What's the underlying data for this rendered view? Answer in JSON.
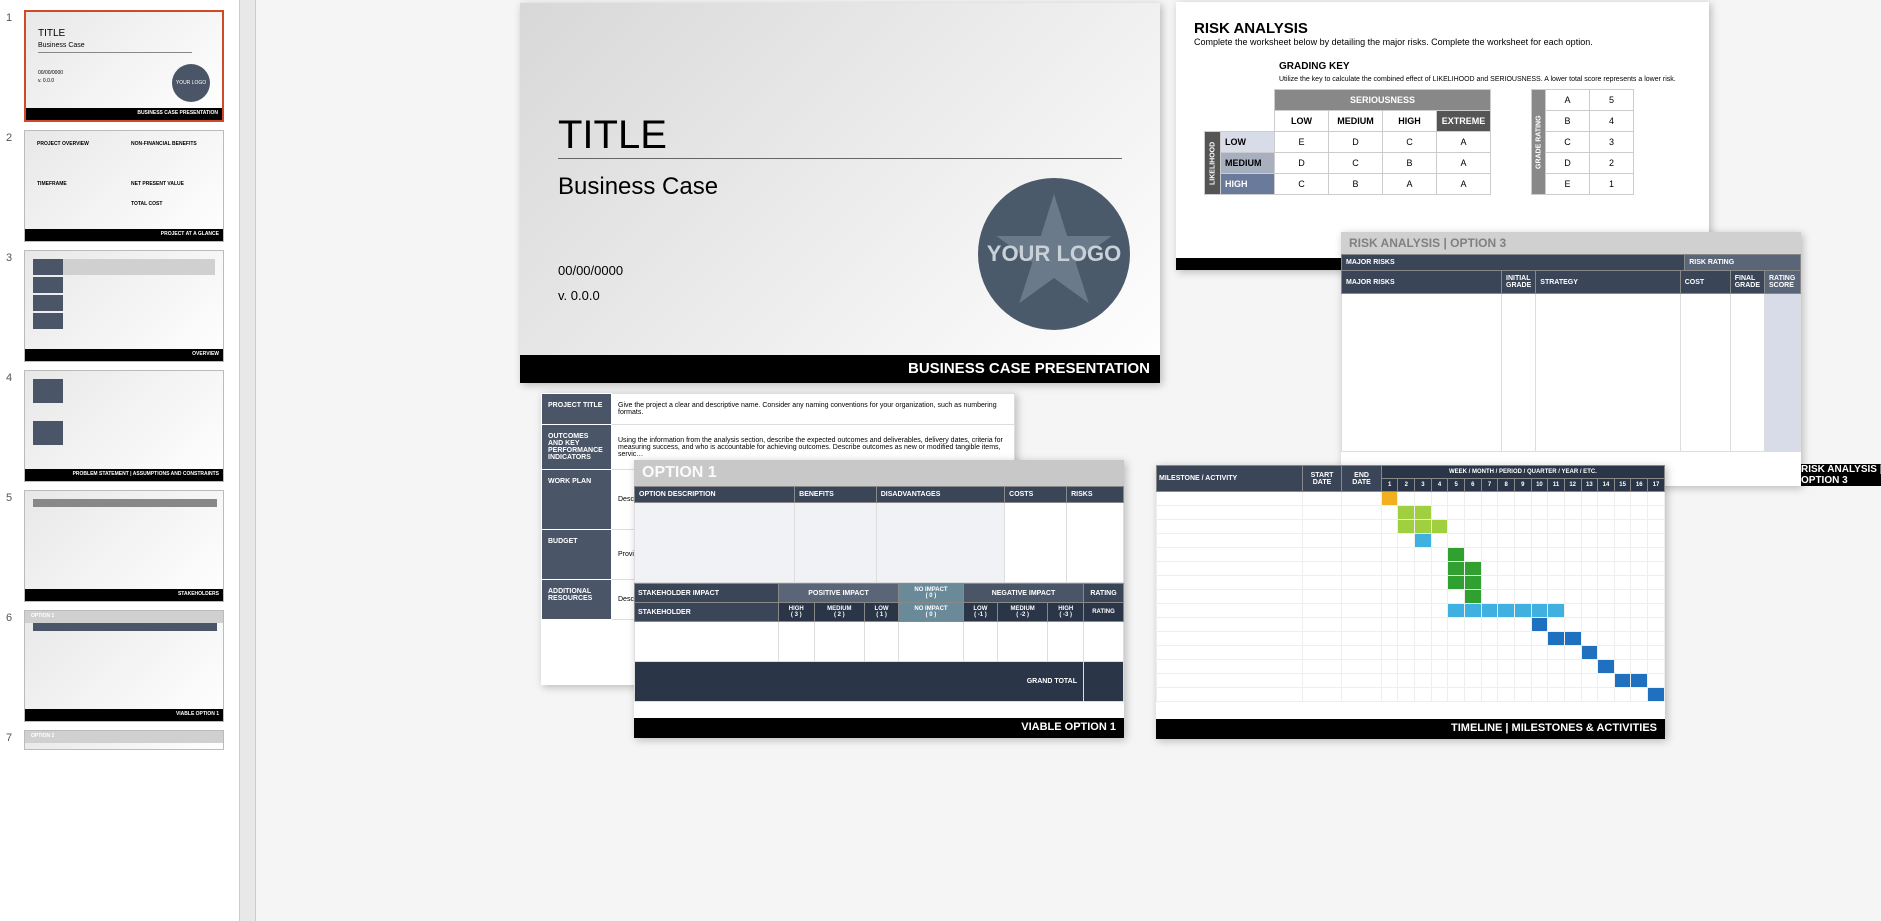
{
  "thumbnails": [
    {
      "num": "1",
      "title": "TITLE",
      "sub": "Business Case",
      "footer": "BUSINESS CASE PRESENTATION",
      "logo": "YOUR LOGO",
      "date": "00/00/0000",
      "ver": "v. 0.0.0"
    },
    {
      "num": "2",
      "footer": "PROJECT AT A GLANCE",
      "sections": [
        "PROJECT OVERVIEW",
        "NON-FINANCIAL BENEFITS",
        "TIMEFRAME",
        "NET PRESENT VALUE",
        "TOTAL COST"
      ]
    },
    {
      "num": "3",
      "footer": "OVERVIEW"
    },
    {
      "num": "4",
      "footer": "PROBLEM STATEMENT | ASSUMPTIONS AND CONSTRAINTS"
    },
    {
      "num": "5",
      "footer": "STAKEHOLDERS"
    },
    {
      "num": "6",
      "header": "OPTION 1",
      "footer": "VIABLE OPTION 1"
    },
    {
      "num": "7",
      "header": "OPTION 2"
    }
  ],
  "main_slide": {
    "title": "TITLE",
    "subtitle": "Business Case",
    "date": "00/00/0000",
    "version": "v. 0.0.0",
    "logo": "YOUR LOGO",
    "footer": "BUSINESS CASE PRESENTATION"
  },
  "risk_analysis": {
    "title": "RISK ANALYSIS",
    "desc": "Complete the worksheet below by detailing the major risks.  Complete the worksheet for each option.",
    "grading_key": "GRADING KEY",
    "grading_desc": "Utilize the key to calculate the combined effect of LIKELIHOOD and SERIOUSNESS. A lower total score represents a lower risk.",
    "seriousness": "SERIOUSNESS",
    "likelihood": "LIKELIHOOD",
    "grade_rating": "GRADE RATING",
    "cols": [
      "LOW",
      "MEDIUM",
      "HIGH",
      "EXTREME"
    ],
    "rows": [
      "LOW",
      "MEDIUM",
      "HIGH"
    ],
    "matrix": [
      [
        "E",
        "D",
        "C",
        "A"
      ],
      [
        "D",
        "C",
        "B",
        "A"
      ],
      [
        "C",
        "B",
        "A",
        "A"
      ]
    ],
    "grades": [
      [
        "A",
        "5"
      ],
      [
        "B",
        "4"
      ],
      [
        "C",
        "3"
      ],
      [
        "D",
        "2"
      ],
      [
        "E",
        "1"
      ]
    ]
  },
  "risk_option3": {
    "header": "RISK ANALYSIS | OPTION 3",
    "cols": [
      "RISK RATING",
      "MAJOR RISKS",
      "INITIAL GRADE",
      "STRATEGY",
      "COST",
      "FINAL GRADE",
      "RATING SCORE"
    ],
    "footer": "RISK ANALYSIS | OPTION 3"
  },
  "project_details": {
    "rows": [
      {
        "label": "PROJECT TITLE",
        "text": "Give the project a clear and descriptive name. Consider any naming conventions for your organization, such as numbering formats."
      },
      {
        "label": "OUTCOMES AND KEY PERFORMANCE INDICATORS",
        "text": "Using the information from the analysis section, describe the expected outcomes and deliverables, delivery dates, criteria for measuring success, and who is accountable for achieving outcomes. Describe outcomes as new or modified tangible items, servic…"
      },
      {
        "label": "WORK PLAN",
        "text": "Descr…"
      },
      {
        "label": "BUDGET",
        "text": "Provi…"
      },
      {
        "label": "ADDITIONAL RESOURCES",
        "text": "Descr…"
      }
    ]
  },
  "option1": {
    "header": "OPTION 1",
    "cols": [
      "OPTION DESCRIPTION",
      "BENEFITS",
      "DISADVANTAGES",
      "COSTS",
      "RISKS"
    ],
    "impact_header": "STAKEHOLDER IMPACT",
    "positive": "POSITIVE IMPACT",
    "negative": "NEGATIVE IMPACT",
    "stakeholder": "STAKEHOLDER",
    "rating": "RATING",
    "scale": [
      {
        "label": "HIGH",
        "val": "( 3 )"
      },
      {
        "label": "MEDIUM",
        "val": "( 2 )"
      },
      {
        "label": "LOW",
        "val": "( 1 )"
      },
      {
        "label": "NO IMPACT",
        "val": "( 0 )"
      },
      {
        "label": "LOW",
        "val": "( -1 )"
      },
      {
        "label": "MEDIUM",
        "val": "( -2 )"
      },
      {
        "label": "HIGH",
        "val": "( -3 )"
      }
    ],
    "grand_total": "GRAND TOTAL",
    "footer": "VIABLE OPTION 1"
  },
  "timeline": {
    "activity": "MILESTONE / ACTIVITY",
    "start": "START DATE",
    "end": "END DATE",
    "period": "WEEK / MONTH / PERIOD / QUARTER / YEAR / ETC.",
    "periods": [
      "1",
      "2",
      "3",
      "4",
      "5",
      "6",
      "7",
      "8",
      "9",
      "10",
      "11",
      "12",
      "13",
      "14",
      "15",
      "16",
      "17"
    ],
    "gantt": [
      [
        0,
        "y"
      ],
      [
        1,
        "lg"
      ],
      [
        2,
        "lg"
      ],
      [
        1,
        "lg"
      ],
      [
        2,
        "lg"
      ],
      [
        3,
        "lg"
      ],
      [
        2,
        "g"
      ],
      [
        4,
        "g"
      ],
      [
        5,
        "g"
      ],
      [
        4,
        "g"
      ],
      [
        5,
        "g"
      ],
      [
        4,
        "lb"
      ],
      [
        5,
        "lb"
      ],
      [
        6,
        "lb"
      ],
      [
        7,
        "lb"
      ],
      [
        8,
        "lb"
      ],
      [
        9,
        "lb"
      ],
      [
        10,
        "lb"
      ],
      [
        10,
        "b"
      ],
      [
        11,
        "b"
      ],
      [
        12,
        "b"
      ],
      [
        13,
        "b"
      ],
      [
        14,
        "b"
      ],
      [
        15,
        "b"
      ],
      [
        16,
        "b"
      ]
    ],
    "footer": "TIMELINE | MILESTONES & ACTIVITIES"
  }
}
